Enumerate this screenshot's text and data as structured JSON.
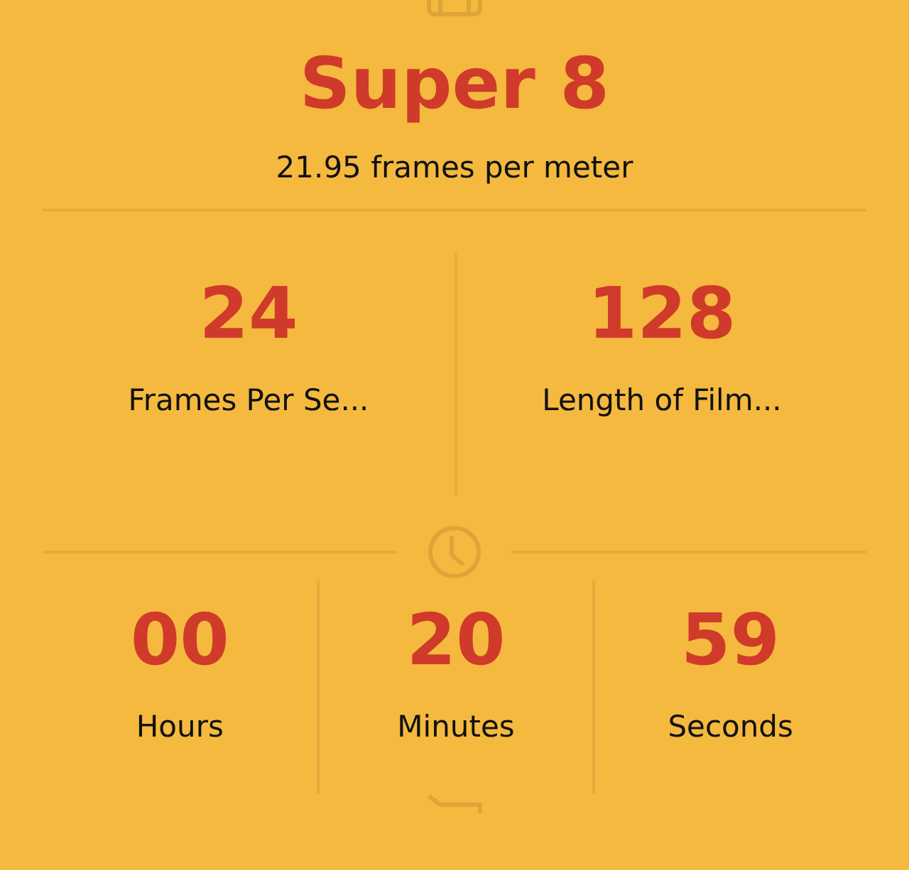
{
  "format": {
    "title": "Super 8",
    "subtitle": "21.95 frames per meter"
  },
  "inputs": [
    {
      "value": "24",
      "label": "Frames Per Se..."
    },
    {
      "value": "128",
      "label": "Length of Film..."
    }
  ],
  "duration": [
    {
      "value": "00",
      "label": "Hours"
    },
    {
      "value": "20",
      "label": "Minutes"
    },
    {
      "value": "59",
      "label": "Seconds"
    }
  ]
}
